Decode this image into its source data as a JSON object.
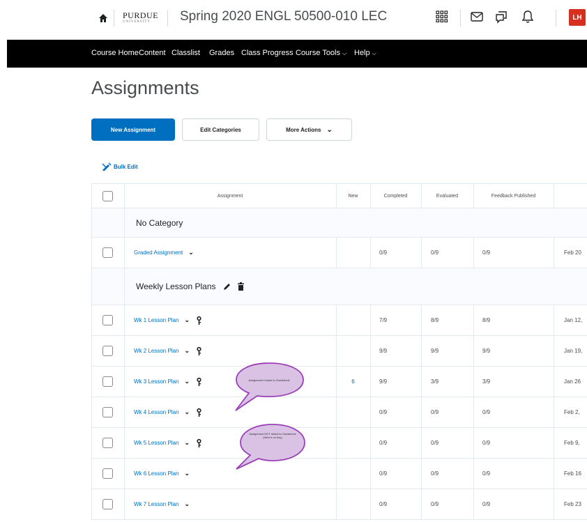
{
  "header": {
    "logo_text": "PURDUE",
    "logo_sub": "UNIVERSITY",
    "course_title": "Spring 2020 ENGL 50500-010 LEC",
    "avatar_initials": "LH",
    "icons": [
      "home-icon",
      "apps-grid-icon",
      "mail-icon",
      "chat-icon",
      "bell-icon"
    ]
  },
  "nav": {
    "items": [
      {
        "label": "Course Home"
      },
      {
        "label": "Content"
      },
      {
        "label": "Classlist"
      },
      {
        "label": "Grades"
      },
      {
        "label": "Class Progress"
      },
      {
        "label": "Course Tools",
        "dropdown": true
      },
      {
        "label": "Help",
        "dropdown": true
      }
    ]
  },
  "page": {
    "title": "Assignments"
  },
  "toolbar": {
    "new_assignment": "New Assignment",
    "edit_categories": "Edit Categories",
    "more_actions": "More Actions",
    "bulk_edit": "Bulk Edit"
  },
  "table": {
    "columns": [
      "Assignment",
      "New",
      "Completed",
      "Evaluated",
      "Feedback Published"
    ],
    "categories": [
      {
        "name": "No Category"
      },
      {
        "name": "Weekly Lesson Plans"
      }
    ],
    "rows": [
      {
        "name": "Graded Assignment",
        "new": "",
        "completed": "0/9",
        "evaluated": "0/9",
        "feedback": "0/9",
        "date": "Feb 20"
      },
      {
        "name": "Wk 1 Lesson Plan",
        "new": "",
        "completed": "7/9",
        "evaluated": "8/9",
        "feedback": "8/9",
        "date": "Jan 12,"
      },
      {
        "name": "Wk 2 Lesson Plan",
        "new": "",
        "completed": "9/9",
        "evaluated": "9/9",
        "feedback": "9/9",
        "date": "Jan 19,"
      },
      {
        "name": "Wk 3 Lesson Plan",
        "new": "6",
        "completed": "9/9",
        "evaluated": "3/9",
        "feedback": "3/9",
        "date": "Jan 26"
      },
      {
        "name": "Wk 4 Lesson Plan",
        "new": "",
        "completed": "0/9",
        "evaluated": "0/9",
        "feedback": "0/9",
        "date": "Feb 2,"
      },
      {
        "name": "Wk 5 Lesson Plan",
        "new": "",
        "completed": "0/9",
        "evaluated": "0/9",
        "feedback": "0/9",
        "date": "Feb 9,"
      },
      {
        "name": "Wk 6 Lesson Plan",
        "new": "",
        "completed": "0/9",
        "evaluated": "0/9",
        "feedback": "0/9",
        "date": "Feb 16"
      },
      {
        "name": "Wk 7 Lesson Plan",
        "new": "",
        "completed": "0/9",
        "evaluated": "0/9",
        "feedback": "0/9",
        "date": "Feb 23"
      }
    ]
  },
  "annotations": {
    "bubble1": "Assignment Linked to Gradebook",
    "bubble2": "Assignment NOT linked to Gradebook (there's no key)"
  },
  "colors": {
    "accent": "#006fbf",
    "nav_bg": "#000000",
    "avatar": "#d7301f",
    "bubble_fill": "#d9c2e4",
    "bubble_stroke": "#9b3fb8"
  }
}
